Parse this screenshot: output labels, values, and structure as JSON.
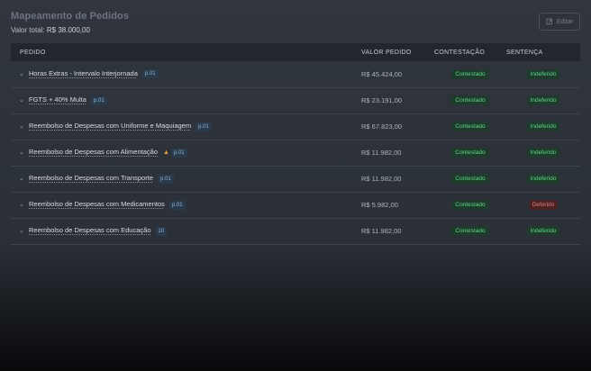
{
  "header": {
    "title": "Mapeamento de Pedidos",
    "total_label": "Valor total:",
    "total_value": "R$ 38.000,00",
    "edit_label": "Editar"
  },
  "table": {
    "columns": [
      "PEDIDO",
      "VALOR PEDIDO",
      "CONTESTAÇÃO",
      "SENTENÇA"
    ],
    "rows": [
      {
        "pedido": "Horas Extras - Intervalo Interjornada",
        "tag": "p.01",
        "warn": false,
        "valor": "R$ 45.424,00",
        "contestacao": "Contestado",
        "sentenca": "Indeferido",
        "sentenca_status": "green"
      },
      {
        "pedido": "FGTS + 40% Multa",
        "tag": "p.01",
        "warn": false,
        "valor": "R$ 23.191,00",
        "contestacao": "Contestado",
        "sentenca": "Indeferido",
        "sentenca_status": "green"
      },
      {
        "pedido": "Reembolso de Despesas com Uniforme e Maquiagem",
        "tag": "p.01",
        "warn": false,
        "valor": "R$ 67.823,00",
        "contestacao": "Contestado",
        "sentenca": "Indeferido",
        "sentenca_status": "green"
      },
      {
        "pedido": "Reembolso de Despesas com Alimentação",
        "tag": "p.01",
        "warn": true,
        "valor": "R$ 11.982,00",
        "contestacao": "Contestado",
        "sentenca": "Indeferido",
        "sentenca_status": "green"
      },
      {
        "pedido": "Reembolso de Despesas com Transporte",
        "tag": "p.01",
        "warn": false,
        "valor": "R$ 11.982,00",
        "contestacao": "Contestado",
        "sentenca": "Indeferido",
        "sentenca_status": "green"
      },
      {
        "pedido": "Reembolso de Despesas com Medicamentos",
        "tag": "p.01",
        "warn": false,
        "valor": "R$ 5.982,00",
        "contestacao": "Contestado",
        "sentenca": "Deferido",
        "sentenca_status": "red"
      },
      {
        "pedido": "Reembolso de Despesas com Educação",
        "tag": "10",
        "warn": false,
        "valor": "R$ 11.982,00",
        "contestacao": "Contestado",
        "sentenca": "Indeferido",
        "sentenca_status": "green"
      }
    ]
  },
  "icons": {
    "edit": "edit-icon",
    "row_toggle": "chevron-down-icon",
    "warning": "warning-icon"
  }
}
